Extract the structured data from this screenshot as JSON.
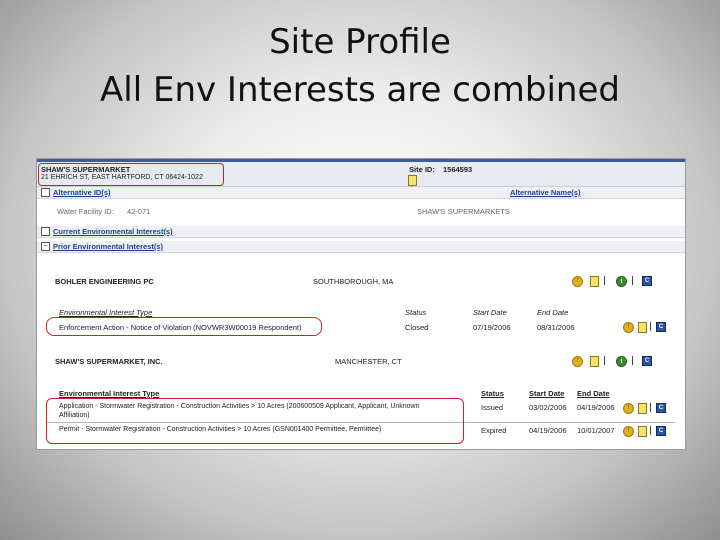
{
  "slide": {
    "title_line1": "Site Profile",
    "title_line2": "All Env Interests are combined"
  },
  "site": {
    "name": "SHAW'S SUPERMARKET",
    "address": "21 EHRICH ST, EAST HARTFORD, CT 06424-1022",
    "id_label": "Site ID:",
    "id_value": "1564593"
  },
  "sections": {
    "alt_ids": "Alternative ID(s)",
    "alt_names": "Alternative Name(s)",
    "current_env": "Current Environmental Interest(s)",
    "prior_env": "Prior Environmental Interest(s)",
    "alt_id_row_label": "Water Facility ID:",
    "alt_id_row_value": "42-071",
    "alt_name_row_value": "SHAW'S SUPERMARKETS"
  },
  "columns": {
    "env_type": "Environmental Interest Type",
    "status": "Status",
    "start": "Start Date",
    "end": "End Date"
  },
  "groups": [
    {
      "org": "BOHLER ENGINEERING PC",
      "location": "SOUTHBOROUGH, MA",
      "rows": [
        {
          "type": "Enforcement Action - Notice of Violation (NOVWR3W00019 Respondent)",
          "status": "Closed",
          "start": "07/19/2006",
          "end": "08/31/2006"
        }
      ]
    },
    {
      "org": "SHAW'S SUPERMARKET, INC.",
      "location": "MANCHESTER, CT",
      "rows": [
        {
          "type": "Application - Stormwater Registration - Construction Activities > 10 Acres (200600509 Applicant, Applicant, Unknown",
          "type_cont": "Affiliation)",
          "status": "Issued",
          "start": "03/02/2006",
          "end": "04/19/2006"
        },
        {
          "type": "Permit - Stormwater Registration - Construction Activities > 10 Acres (GSN001400 Permittee, Permittee)",
          "status": "Expired",
          "start": "04/19/2006",
          "end": "10/01/2007"
        }
      ]
    }
  ],
  "icons": {
    "warn": "warning-icon",
    "doc": "document-icon",
    "info": "info-icon",
    "detail": "detail-icon",
    "info_glyph": "i",
    "detail_glyph": "C",
    "warn_glyph": "!"
  },
  "colors": {
    "highlight": "#d62020",
    "link": "#1a3f8a",
    "header_band": "#e7ebf1"
  }
}
